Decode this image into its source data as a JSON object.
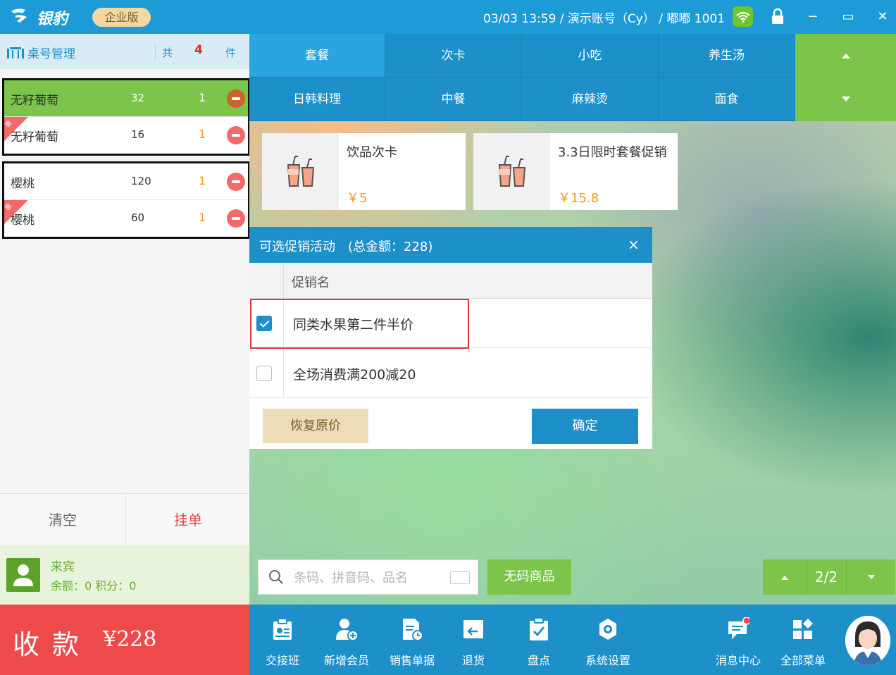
{
  "app": {
    "logo_text": "银豹",
    "edition": "企业版",
    "status_info": "03/03 13:59 / 演示账号（Cy） / 嘟嘟 1001",
    "colors": {
      "primary": "#1d8fc9",
      "accent_green": "#7cc44a",
      "checkout_red": "#ef4a4a",
      "price_orange": "#f29a1e"
    }
  },
  "window_controls": {
    "minimize": "−",
    "maximize": "▭",
    "close": "✕"
  },
  "table_panel": {
    "title": "桌号管理",
    "total_prefix": "共",
    "total_count": "4",
    "total_suffix": "件",
    "groups": [
      {
        "items": [
          {
            "name": "无籽葡萄",
            "price": "32",
            "qty": "1",
            "selected": true,
            "gift": false
          },
          {
            "name": "无籽葡萄",
            "price": "16",
            "qty": "1",
            "selected": false,
            "gift": true,
            "gift_label": "惠"
          }
        ]
      },
      {
        "items": [
          {
            "name": "樱桃",
            "price": "120",
            "qty": "1",
            "selected": false,
            "gift": false
          },
          {
            "name": "樱桃",
            "price": "60",
            "qty": "1",
            "selected": false,
            "gift": true,
            "gift_label": "惠"
          }
        ]
      }
    ],
    "clear_label": "清空",
    "hang_label": "挂单"
  },
  "member": {
    "name": "来宾",
    "info": "余额：0  积分：0"
  },
  "checkout": {
    "label": "收款",
    "amount": "¥228"
  },
  "categories": {
    "row1": [
      "套餐",
      "次卡",
      "小吃",
      "养生汤"
    ],
    "row2": [
      "日韩料理",
      "中餐",
      "麻辣烫",
      "面食"
    ],
    "active": "套餐"
  },
  "products": [
    {
      "name": "饮品次卡",
      "price": "￥5"
    },
    {
      "name": "3.3日限时套餐促销",
      "price": "￥15.8"
    }
  ],
  "dialog": {
    "title": "可选促销活动　(总金额：228)",
    "close": "×",
    "column": "促销名",
    "promotions": [
      {
        "label": "同类水果第二件半价",
        "checked": true
      },
      {
        "label": "全场消费满200减20",
        "checked": false
      }
    ],
    "restore_label": "恢复原价",
    "confirm_label": "确定"
  },
  "search": {
    "placeholder": "条码、拼音码、品名",
    "value": ""
  },
  "nocode_label": "无码商品",
  "pager": {
    "text": "2/2"
  },
  "toolbar": {
    "items": [
      {
        "label": "交接班",
        "icon": "handover-icon"
      },
      {
        "label": "新增会员",
        "icon": "add-member-icon"
      },
      {
        "label": "销售单据",
        "icon": "sales-receipt-icon"
      },
      {
        "label": "退货",
        "icon": "return-icon"
      },
      {
        "label": "盘点",
        "icon": "inventory-icon"
      },
      {
        "label": "系统设置",
        "icon": "settings-icon"
      },
      {
        "label": "消息中心",
        "icon": "message-icon"
      },
      {
        "label": "全部菜单",
        "icon": "all-menu-icon"
      }
    ]
  }
}
